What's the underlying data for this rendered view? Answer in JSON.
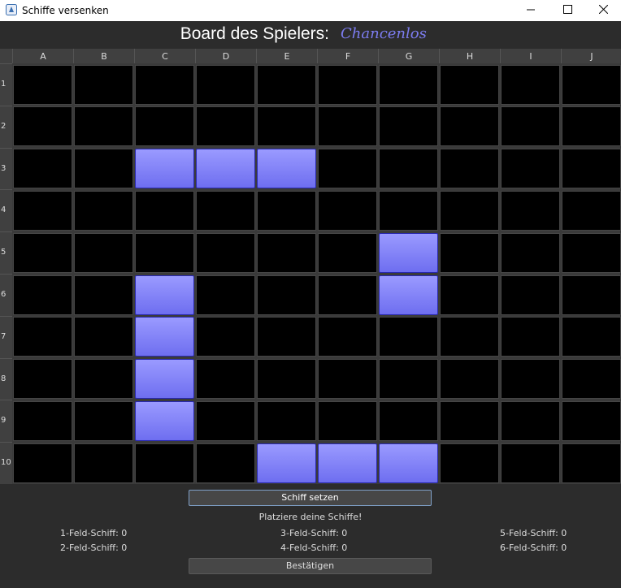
{
  "window": {
    "title": "Schiffe versenken",
    "icons": {
      "app": "java-cup-icon",
      "minimize": "minimize-icon",
      "maximize": "maximize-icon",
      "close": "close-icon"
    }
  },
  "header": {
    "label": "Board des Spielers:",
    "player_name": "Chancenlos",
    "player_name_color": "#7c7cf0"
  },
  "board": {
    "columns": [
      "A",
      "B",
      "C",
      "D",
      "E",
      "F",
      "G",
      "H",
      "I",
      "J"
    ],
    "rows": [
      "1",
      "2",
      "3",
      "4",
      "5",
      "6",
      "7",
      "8",
      "9",
      "10"
    ],
    "ship_cells": [
      "C3",
      "D3",
      "E3",
      "G5",
      "G6",
      "C6",
      "C7",
      "C8",
      "C9",
      "E10",
      "F10",
      "G10"
    ],
    "cell_color": "#000000",
    "ship_color": "#7e7ef6"
  },
  "controls": {
    "place_button": "Schiff setzen",
    "status": "Platziere deine Schiffe!",
    "confirm_button": "Bestätigen"
  },
  "ship_counts": [
    {
      "label": "1-Feld-Schiff: 0"
    },
    {
      "label": "2-Feld-Schiff: 0"
    },
    {
      "label": "3-Feld-Schiff: 0"
    },
    {
      "label": "4-Feld-Schiff: 0"
    },
    {
      "label": "5-Feld-Schiff: 0"
    },
    {
      "label": "6-Feld-Schiff: 0"
    }
  ]
}
